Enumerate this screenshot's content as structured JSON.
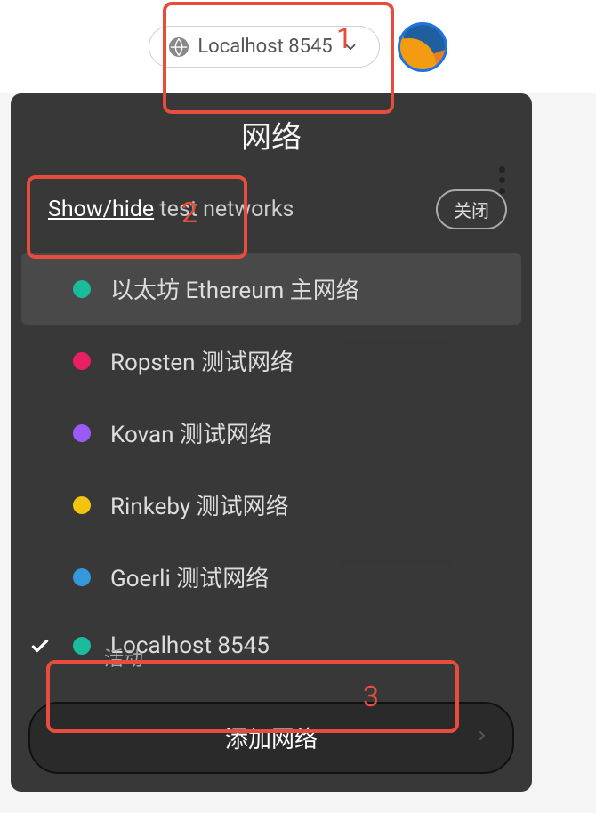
{
  "header": {
    "selected_network": "Localhost 8545"
  },
  "modal": {
    "title": "网络",
    "toggle_prefix": "Show/hide",
    "toggle_suffix": " test networks",
    "close_label": "关闭",
    "activity_label": "活动",
    "networks": [
      {
        "label": "以太坊 Ethereum 主网络",
        "color": "#1abc9c",
        "selected": false,
        "highlighted": true
      },
      {
        "label": "Ropsten 测试网络",
        "color": "#e91e63",
        "selected": false,
        "highlighted": false
      },
      {
        "label": "Kovan 测试网络",
        "color": "#9b59f6",
        "selected": false,
        "highlighted": false
      },
      {
        "label": "Rinkeby 测试网络",
        "color": "#f1c40f",
        "selected": false,
        "highlighted": false
      },
      {
        "label": "Goerli 测试网络",
        "color": "#3498db",
        "selected": false,
        "highlighted": false
      },
      {
        "label": "Localhost 8545",
        "color": "#1abc9c",
        "selected": true,
        "highlighted": false
      }
    ],
    "add_network_label": "添加网络"
  },
  "annotations": {
    "a1": "1",
    "a2": "2",
    "a3": "3"
  }
}
